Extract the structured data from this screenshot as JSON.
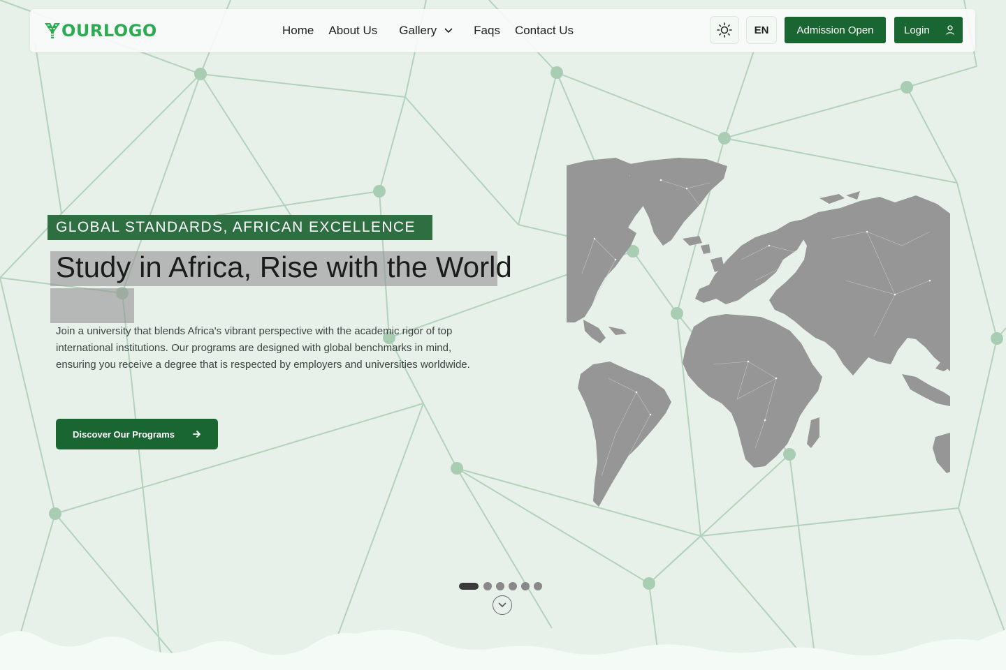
{
  "brand": {
    "logo_text": "OURLOGO",
    "logo_initial": "Y",
    "accent": "#2cab53",
    "primary": "#1a6632"
  },
  "nav": {
    "items": [
      {
        "label": "Home"
      },
      {
        "label": "About Us"
      },
      {
        "label": "Gallery",
        "has_dropdown": true
      },
      {
        "label": "Faqs"
      },
      {
        "label": "Contact Us"
      }
    ]
  },
  "header_actions": {
    "theme_toggle_icon": "sun-icon",
    "language": "EN",
    "admission_label": "Admission Open",
    "login_label": "Login",
    "login_icon": "user-icon"
  },
  "hero": {
    "eyebrow": "GLOBAL STANDARDS, AFRICAN EXCELLENCE",
    "title": "Study in Africa, Rise with the World",
    "description": "Join a university that blends Africa's vibrant perspective with the academic rigor of top international institutions. Our programs are designed with global benchmarks in mind, ensuring you receive a degree that is respected by employers and universities worldwide.",
    "cta_label": "Discover Our Programs",
    "cta_icon": "arrow-right-icon",
    "image": "world-map"
  },
  "carousel": {
    "total_slides": 6,
    "active_index": 0
  },
  "scroll_indicator_icon": "chevron-down-circle-icon"
}
